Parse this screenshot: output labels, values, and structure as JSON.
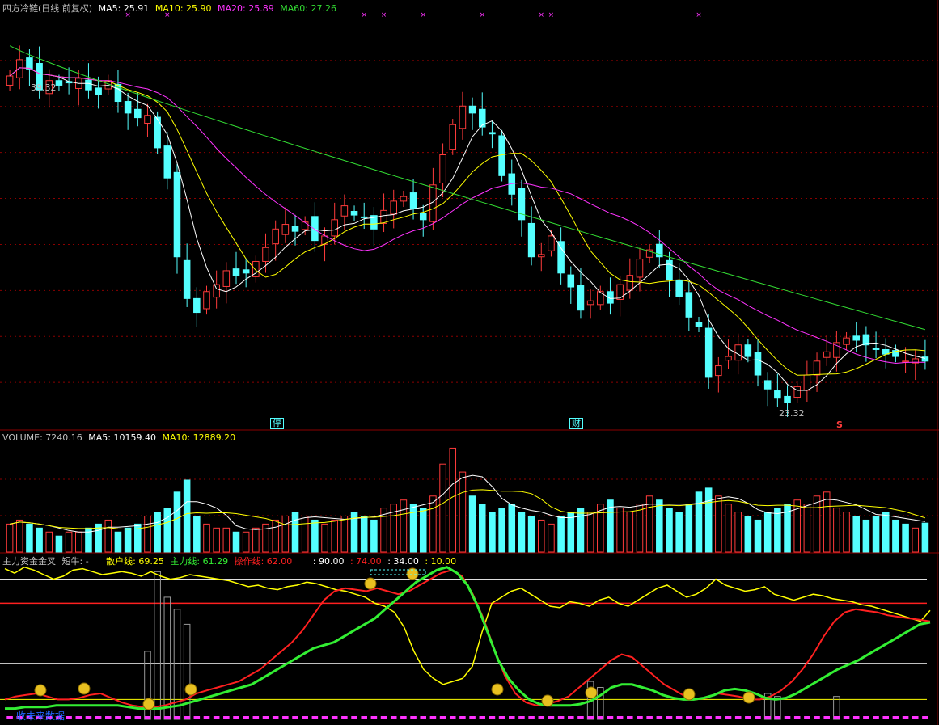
{
  "colors": {
    "up": "#ff3b3b",
    "down": "#54ffff",
    "ma5": "#ffffff",
    "ma10": "#ffff00",
    "ma20": "#ff33ff",
    "ma60": "#33dd33",
    "grid": "#8b0000",
    "retail": "#ffff00",
    "main": "#33ee33",
    "operate": "#ff2020",
    "wave": "#999999",
    "bottom_bar": "#ff33ff"
  },
  "header": {
    "title": "四方冷链(日线 前复权)",
    "ma5": "MA5: 25.91",
    "ma10": "MA10: 25.90",
    "ma20": "MA20: 25.89",
    "ma60": "MA60: 27.26"
  },
  "volume_header": {
    "volume": "VOLUME: 7240.16",
    "ma5": "MA5: 10159.40",
    "ma10": "MA10: 12889.20"
  },
  "indicator_header": {
    "name": "主力资金金叉",
    "short_bull": "短牛: -",
    "retail": "散户线: 69.25",
    "main": "主力线: 61.29",
    "operate": "操作线: 62.00",
    "l90": ": 90.00",
    "l74": ": 74.00",
    "l34": ": 34.00",
    "l10": ": 10.00"
  },
  "annotations": {
    "high_label": "39.32",
    "low_label": "23.32",
    "marker_ting": "停",
    "marker_cai": "财",
    "marker_s": "S",
    "bottom_watermark": "收未来数据"
  },
  "chart_data": [
    {
      "type": "candlestick",
      "title": "四方冷链(日线 前复权)",
      "ylim": [
        23.0,
        40.5
      ],
      "high": 39.32,
      "low": 23.32,
      "close": [
        38.2,
        38.9,
        38.5,
        37.6,
        38.0,
        37.8,
        37.9,
        38.1,
        37.6,
        37.4,
        38.0,
        37.1,
        36.6,
        36.4,
        36.5,
        35.1,
        33.8,
        30.4,
        28.6,
        28.0,
        28.9,
        29.2,
        29.8,
        29.6,
        29.7,
        30.2,
        30.8,
        31.6,
        31.8,
        31.5,
        31.9,
        31.1,
        31.3,
        32.0,
        32.6,
        32.2,
        32.1,
        31.6,
        32.4,
        32.8,
        33.0,
        32.5,
        32.0,
        33.5,
        34.8,
        36.1,
        36.9,
        36.6,
        36.0,
        35.7,
        33.9,
        33.1,
        32.0,
        30.4,
        30.5,
        31.3,
        29.7,
        29.1,
        28.1,
        28.5,
        28.9,
        28.4,
        29.2,
        29.6,
        30.3,
        30.7,
        30.4,
        29.4,
        28.7,
        27.8,
        27.4,
        25.2,
        25.7,
        26.1,
        26.6,
        26.1,
        25.3,
        24.7,
        24.3,
        24.1,
        24.8,
        25.3,
        25.9,
        26.3,
        26.7,
        26.9,
        26.8,
        26.6,
        26.4,
        26.2,
        26.1,
        25.9,
        26.0,
        25.9
      ],
      "ma5_last": 25.91,
      "ma10_last": 25.9,
      "ma20_last": 25.89,
      "ma60_last": 27.26
    },
    {
      "type": "bar",
      "title": "VOLUME",
      "values": [
        7,
        8,
        7,
        6,
        5,
        4,
        5,
        5,
        6,
        7,
        8,
        5,
        6,
        7,
        9,
        10,
        11,
        15,
        18,
        9,
        7,
        6,
        6,
        5,
        5,
        6,
        7,
        8,
        9,
        10,
        9,
        8,
        7,
        8,
        9,
        10,
        9,
        8,
        11,
        12,
        13,
        12,
        11,
        14,
        22,
        26,
        20,
        14,
        12,
        10,
        11,
        12,
        10,
        9,
        8,
        7,
        9,
        10,
        11,
        10,
        12,
        13,
        11,
        10,
        12,
        14,
        13,
        11,
        10,
        12,
        15,
        16,
        14,
        12,
        10,
        9,
        8,
        10,
        11,
        12,
        13,
        12,
        14,
        15,
        11,
        10,
        9,
        8,
        9,
        10,
        8,
        7,
        6,
        7.24
      ],
      "ma5_last": 10159.4,
      "ma10_last": 12889.2,
      "current": 7240.16
    },
    {
      "type": "line",
      "title": "主力资金金叉",
      "ylim": [
        0,
        100
      ],
      "levels": [
        90,
        74,
        34,
        10
      ],
      "series": [
        {
          "name": "散户线",
          "values": [
            97,
            94,
            98,
            96,
            93,
            90,
            92,
            96,
            97,
            95,
            93,
            94,
            95,
            94,
            92,
            95,
            92,
            90,
            91,
            93,
            92,
            91,
            90,
            89,
            87,
            85,
            86,
            84,
            83,
            85,
            86,
            88,
            87,
            85,
            83,
            82,
            80,
            78,
            74,
            72,
            68,
            58,
            42,
            30,
            24,
            20,
            22,
            24,
            32,
            55,
            74,
            78,
            82,
            84,
            80,
            76,
            72,
            71,
            75,
            74,
            72,
            76,
            78,
            74,
            72,
            76,
            80,
            84,
            86,
            82,
            78,
            80,
            84,
            90,
            86,
            84,
            82,
            83,
            85,
            80,
            78,
            76,
            78,
            80,
            79,
            77,
            76,
            75,
            73,
            72,
            70,
            68,
            66,
            64,
            62,
            69.25
          ]
        },
        {
          "name": "主力线",
          "values": [
            4,
            4,
            5,
            5,
            5,
            6,
            6,
            6,
            6,
            6,
            6,
            6,
            5,
            4,
            4,
            4,
            5,
            6,
            8,
            10,
            12,
            14,
            16,
            18,
            20,
            24,
            28,
            32,
            36,
            40,
            44,
            46,
            48,
            52,
            56,
            60,
            64,
            70,
            76,
            82,
            88,
            92,
            96,
            98,
            94,
            86,
            72,
            54,
            36,
            24,
            16,
            10,
            7,
            6,
            6,
            6,
            7,
            9,
            13,
            18,
            20,
            20,
            18,
            16,
            13,
            11,
            10,
            10,
            11,
            13,
            16,
            17,
            16,
            14,
            11,
            10,
            11,
            14,
            18,
            22,
            26,
            30,
            33,
            36,
            40,
            44,
            48,
            52,
            56,
            60,
            61.29
          ]
        },
        {
          "name": "操作线",
          "values": [
            10,
            12,
            13,
            14,
            12,
            10,
            10,
            11,
            13,
            14,
            11,
            8,
            6,
            5,
            5,
            6,
            8,
            10,
            14,
            16,
            18,
            20,
            22,
            26,
            30,
            36,
            42,
            48,
            56,
            66,
            76,
            82,
            84,
            83,
            82,
            84,
            82,
            80,
            82,
            86,
            90,
            94,
            96,
            92,
            80,
            64,
            44,
            26,
            14,
            8,
            6,
            7,
            9,
            12,
            18,
            24,
            30,
            36,
            40,
            38,
            32,
            26,
            20,
            16,
            12,
            10,
            11,
            14,
            13,
            12,
            10,
            10,
            12,
            16,
            22,
            30,
            40,
            52,
            62,
            68,
            70,
            69,
            68,
            66,
            65,
            64,
            63,
            62
          ]
        }
      ]
    }
  ]
}
